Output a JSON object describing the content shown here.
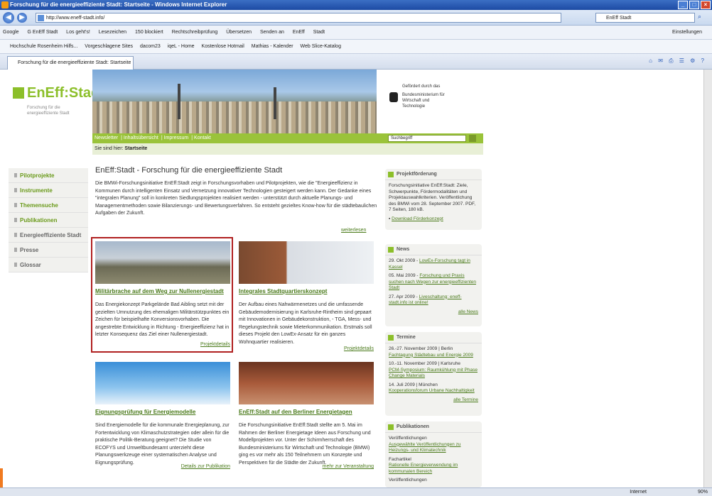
{
  "window": {
    "title": "Forschung für die energieeffiziente Stadt: Startseite - Windows Internet Explorer"
  },
  "address": {
    "url": "http://www.eneff-stadt.info/",
    "search_value": "EnEff Stadt"
  },
  "googlebar": {
    "items": [
      "Google",
      "G EnEff Stadt",
      "Los geht's!",
      "Lesezeichen",
      "150 blockiert",
      "Rechtschreibprüfung",
      "Übersetzen",
      "Senden an",
      "EnEff",
      "Stadt"
    ],
    "settings": "Einstellungen"
  },
  "favorites": {
    "items": [
      "Hochschule Rosenheim Hilfs...",
      "Vorgeschlagene Sites",
      "dacom23",
      "iqeL - Home",
      "Kostenlose Hotmail",
      "Mathias - Kalender",
      "Web Slice-Katalog"
    ]
  },
  "tab": {
    "label": "Forschung für die energieeffiziente Stadt: Startseite"
  },
  "site": {
    "logo_main": "EnEff:Stadt",
    "logo_sub": "Forschung für die energieeffiziente Stadt",
    "ministry": {
      "kicker": "Gefördert durch das",
      "name": "Bundesministerium für Wirtschaft und Technologie"
    },
    "topnav": [
      "Newsletter",
      "Inhaltsübersicht",
      "Impressum",
      "Kontakt"
    ],
    "search_placeholder": "Suchbegriff",
    "crumb_prefix": "Sie sind hier:",
    "crumb_current": "Startseite"
  },
  "leftnav": [
    "Pilotprojekte",
    "Instrumente",
    "Themensuche",
    "Publikationen",
    "Energieeffiziente Stadt",
    "Presse",
    "Glossar"
  ],
  "main": {
    "title": "EnEff:Stadt - Forschung für die energieeffiziente Stadt",
    "intro": "Die BMWi-Forschungsinitiative EnEff:Stadt zeigt in Forschungsvorhaben und Pilotprojekten, wie die \"Energieeffizienz in Kommunen durch intelligenten Einsatz und Vernetzung innovativer Technologien gesteigert werden kann. Der Gedanke eines \"integralen Planung\" soll in konkreten Siedlungsprojekten realisiert werden - unterstützt durch aktuelle Planungs- und Managementmethoden sowie Bilanzierungs- und Bewertungsverfahren. So entsteht gezieltes Know-how für die städtebaulichen Aufgaben der Zukunft.",
    "weiterlesen": "weiterlesen"
  },
  "cards": [
    {
      "title": "Militärbrache auf dem Weg zur Nullenergiestadt",
      "text": "Das Energiekonzept Parkgelände Bad Aibling setzt mit der gezielten Umnutzung des ehemaligen Militärstützpunktes ein Zeichen für beispielhafte Konversionsvorhaben. Die angestrebte Entwicklung in Richtung - Energieeffizienz hat in letzter Konsequenz das Ziel einer Nullenergiestadt.",
      "more": "Projektdetails"
    },
    {
      "title": "Integrales Stadtquartierskonzept",
      "text": "Der Aufbau eines Nahwärmenetzes und die umfassende Gebäudemodernisierung in Karlsruhe-Rintheim sind gepaart mit Innovationen in Gebäudekonstruktion, - TGA, Mess- und Regelungstechnik sowie Mieterkommunikation. Erstmals soll dieses Projekt den LowEx-Ansatz für ein ganzes Wohnquartier realisieren.",
      "more": "Projektdetails"
    },
    {
      "title": "Eignungsprüfung für Energiemodelle",
      "text": "Sind Energiemodelle für die kommunale Energieplanung, zur Fortentwicklung von Klimaschutzstrategien oder allein für die praktische Politik-Beratung geeignet? Die Studie von ECOFYS und Umweltbundesamt unterzieht diese Planungswerkzeuge einer systematischen Analyse und Eignungsprüfung.",
      "more": "Details zur Publikation"
    },
    {
      "title": "EnEff:Stadt auf den Berliner Energietagen",
      "text": "Die Forschungsinitiative EnEff:Stadt stellte am 5. Mai im Rahmen der Berliner Energietage Ideen aus Forschung und Modellprojekten vor. Unter der Schirmherrschaft des Bundesministeriums für Wirtschaft und Technologie (BMWi) ging es vor mehr als 150 Teilnehmern um Konzepte und Perspektiven für die Städte der Zukunft.",
      "more": "mehr zur Veranstaltung"
    }
  ],
  "sidebar": {
    "foerderung": {
      "title": "Projektförderung",
      "text": "Forschungsinitiative EnEff:Stadt: Ziele, Schwerpunkte, Fördermodalitäten und Projektauswahlkriterien. Veröffentlichung des BMWi vom 28. September 2007. PDF, 7 Seiten, 180 kB.",
      "link": "Download Förderkonzept"
    },
    "news": {
      "title": "News",
      "items": [
        {
          "date": "29. Okt 2009 -",
          "link": "LowEx-Forschung tagt in Kassel"
        },
        {
          "date": "05. Mai 2009 -",
          "link": "Forschung und Praxis suchen nach Wegen zur energieeffizienten Stadt"
        },
        {
          "date": "27. Apr 2009 -",
          "link": "Liveschaltung: eneff-stadt.info ist online!"
        }
      ],
      "all": "alle News"
    },
    "termine": {
      "title": "Termine",
      "items": [
        {
          "date": "26.-27. November 2009 | Berlin",
          "link": "Fachtagung Städtebau und Energie 2009"
        },
        {
          "date": "10.-11. November 2009 | Karlsruhe",
          "link": "PCM-Symposium: Raumkühlung mit Phase Change Materials"
        },
        {
          "date": "14. Juli 2009 | München",
          "link": "Kooperationsforum Urbane Nachhaltigkeit"
        }
      ],
      "all": "alle Termine"
    },
    "publikationen": {
      "title": "Publikationen",
      "items": [
        {
          "date": "Veröffentlichungen",
          "link": "Ausgewählte Veröffentlichungen zu Heizungs- und Klimatechnik"
        },
        {
          "date": "Fachartikel",
          "link": "Rationelle Energieverwendung im kommunalen Bereich"
        },
        {
          "date": "Veröffentlichungen",
          "link": ""
        }
      ]
    }
  },
  "status": {
    "zone": "Internet",
    "zoom": "90%"
  }
}
